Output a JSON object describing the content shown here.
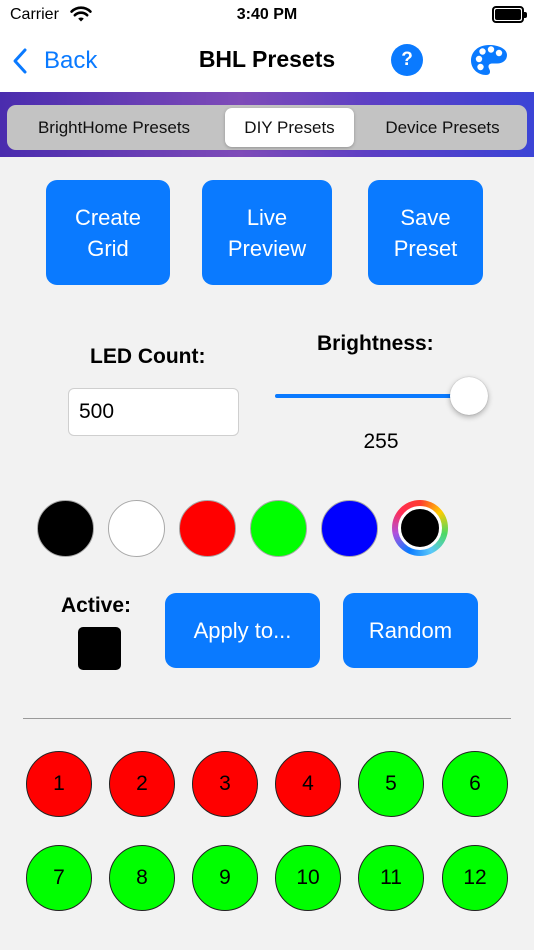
{
  "status_bar": {
    "carrier": "Carrier",
    "time": "3:40 PM"
  },
  "nav": {
    "back_label": "Back",
    "title": "BHL Presets",
    "help_label": "?"
  },
  "tabs": [
    {
      "label": "BrightHome Presets",
      "selected": false
    },
    {
      "label": "DIY Presets",
      "selected": true
    },
    {
      "label": "Device Presets",
      "selected": false
    }
  ],
  "actions": {
    "create_grid": "Create\nGrid",
    "live_preview": "Live\nPreview",
    "save_preset": "Save\nPreset"
  },
  "led_count": {
    "label": "LED Count:",
    "value": "500"
  },
  "brightness": {
    "label": "Brightness:",
    "value": "255",
    "max": 255
  },
  "palette": [
    {
      "name": "black",
      "color": "#000000"
    },
    {
      "name": "white",
      "color": "#ffffff"
    },
    {
      "name": "red",
      "color": "#ff0000"
    },
    {
      "name": "green",
      "color": "#00ff00"
    },
    {
      "name": "blue",
      "color": "#0000ff"
    }
  ],
  "active": {
    "label": "Active:",
    "color": "#000000"
  },
  "buttons": {
    "apply_to": "Apply to...",
    "random": "Random"
  },
  "leds": [
    {
      "number": "1",
      "color": "#ff0000"
    },
    {
      "number": "2",
      "color": "#ff0000"
    },
    {
      "number": "3",
      "color": "#ff0000"
    },
    {
      "number": "4",
      "color": "#ff0000"
    },
    {
      "number": "5",
      "color": "#00ff00"
    },
    {
      "number": "6",
      "color": "#00ff00"
    },
    {
      "number": "7",
      "color": "#00ff00"
    },
    {
      "number": "8",
      "color": "#00ff00"
    },
    {
      "number": "9",
      "color": "#00ff00"
    },
    {
      "number": "10",
      "color": "#00ff00"
    },
    {
      "number": "11",
      "color": "#00ff00"
    },
    {
      "number": "12",
      "color": "#00ff00"
    }
  ],
  "colors": {
    "accent": "#0a7aff"
  }
}
